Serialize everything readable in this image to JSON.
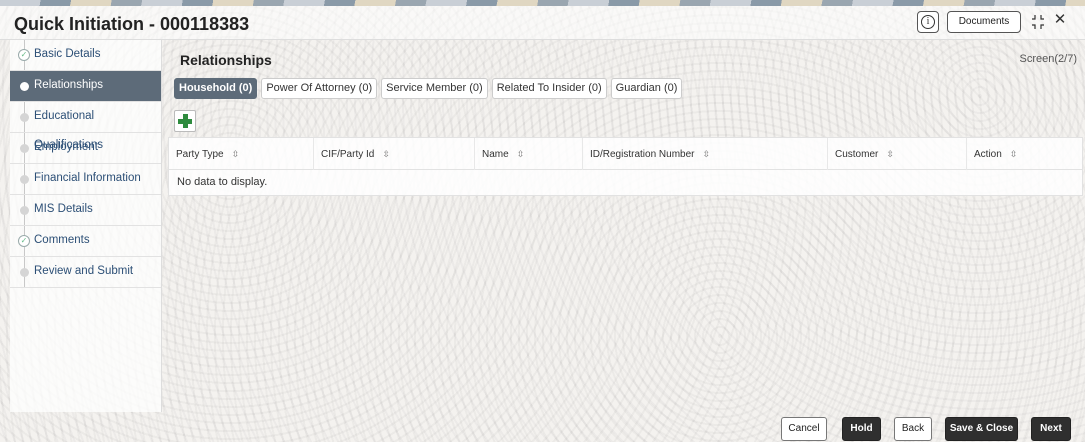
{
  "header": {
    "title": "Quick Initiation - 000118383",
    "info_icon_glyph": "i",
    "documents_label": "Documents",
    "close_glyph": "✕"
  },
  "sidebar": {
    "items": [
      {
        "label": "Basic Details",
        "state": "completed"
      },
      {
        "label": "Relationships",
        "state": "active"
      },
      {
        "label": "Educational Qualifications",
        "state": "pending"
      },
      {
        "label": "Employment",
        "state": "pending"
      },
      {
        "label": "Financial Information",
        "state": "pending"
      },
      {
        "label": "MIS Details",
        "state": "pending"
      },
      {
        "label": "Comments",
        "state": "completed"
      },
      {
        "label": "Review and Submit",
        "state": "pending"
      }
    ]
  },
  "main": {
    "section_title": "Relationships",
    "screen_label": "Screen(2/7)",
    "tabs": [
      {
        "label": "Household (0)",
        "active": true
      },
      {
        "label": "Power Of Attorney (0)",
        "active": false
      },
      {
        "label": "Service Member (0)",
        "active": false
      },
      {
        "label": "Related To Insider (0)",
        "active": false
      },
      {
        "label": "Guardian (0)",
        "active": false
      }
    ],
    "table": {
      "columns": [
        "Party Type",
        "CIF/Party Id",
        "Name",
        "ID/Registration Number",
        "Customer",
        "Action"
      ],
      "sort_glyph": "⇳",
      "empty_message": "No data to display."
    }
  },
  "footer": {
    "cancel": "Cancel",
    "hold": "Hold",
    "back": "Back",
    "save_close": "Save & Close",
    "next": "Next"
  },
  "colors": {
    "active_bg": "#5d6b79",
    "add_green": "#2e8b3e",
    "dark_button": "#2f2f2f"
  }
}
